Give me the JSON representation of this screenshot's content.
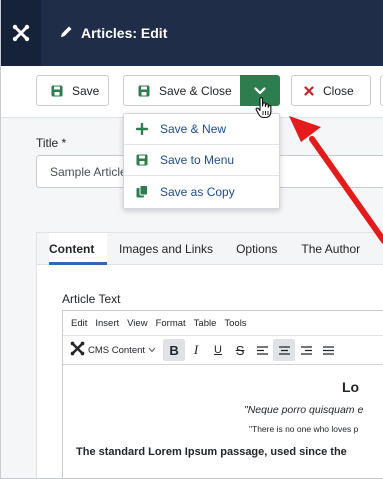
{
  "header": {
    "title": "Articles: Edit",
    "bg_color": "#1f2d49",
    "logo_icon": "joomla-logo-icon",
    "title_icon": "pencil-icon"
  },
  "toolbar": {
    "save_label": "Save",
    "save_close_label": "Save & Close",
    "close_label": "Close",
    "dropdown_color": "#2e7d4f"
  },
  "save_dropdown": {
    "items": [
      {
        "label": "Save & New",
        "icon": "plus-icon"
      },
      {
        "label": "Save to Menu",
        "icon": "save-icon"
      },
      {
        "label": "Save as Copy",
        "icon": "copy-icon"
      }
    ]
  },
  "title_field": {
    "label": "Title *",
    "value": "Sample Article"
  },
  "tabs": [
    {
      "label": "Content",
      "active": true
    },
    {
      "label": "Images and Links",
      "active": false
    },
    {
      "label": "Options",
      "active": false
    },
    {
      "label": "The Author",
      "active": false
    }
  ],
  "editor": {
    "label": "Article Text",
    "menu": [
      "Edit",
      "Insert",
      "View",
      "Format",
      "Table",
      "Tools"
    ],
    "cms_content": "CMS Content",
    "heading_fragment": "Lo",
    "quote_line": "\"Neque porro quisquam e",
    "quote_line2": "\"There is no one who loves p",
    "standard_line": "The standard Lorem Ipsum passage, used since the"
  },
  "annotation": {
    "arrow_color": "#e31b1b"
  }
}
